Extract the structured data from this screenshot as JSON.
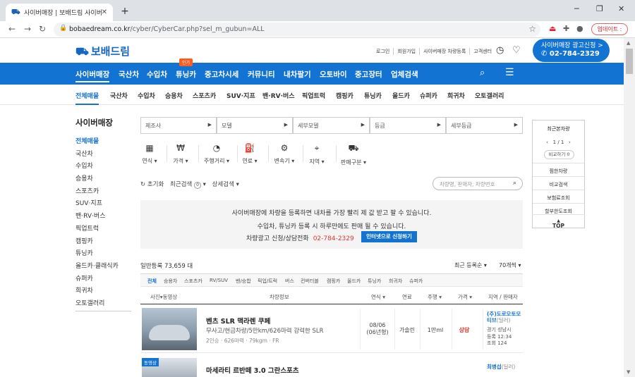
{
  "browser": {
    "tab_title": "사이버매장 | 보배드림 사이버미",
    "url_domain": "bobaedream.co.kr",
    "url_path": "/cyber/CyberCar.php?sel_m_gubun=ALL",
    "update_label": "업데이트 :"
  },
  "header": {
    "logo": "보배드림",
    "top_links": [
      "로그인",
      "회원가입",
      "사이버매장 차량등록",
      "고객센터"
    ],
    "ad_line1": "사이버매장 광고신청 >",
    "ad_line2": "02-784-2329"
  },
  "main_nav": {
    "items": [
      "사이버매장",
      "국산차",
      "수입차",
      "튜닝카",
      "중고차시세",
      "커뮤니티",
      "내차팔기",
      "오토바이",
      "중고장터",
      "업체검색"
    ],
    "hot_badge": "인기"
  },
  "sub_nav": {
    "items": [
      "전체매물",
      "국산차",
      "수입차",
      "승용차",
      "스포츠카",
      "SUV·지프",
      "밴·RV·버스",
      "픽업트럭",
      "캠핑카",
      "튜닝카",
      "올드카",
      "슈퍼카",
      "희귀차",
      "오토갤러리"
    ]
  },
  "sidebar": {
    "title": "사이버매장",
    "items": [
      "전체매물",
      "국산차",
      "수입차",
      "승용차",
      "스포츠카",
      "SUV·지프",
      "밴·RV·버스",
      "픽업트럭",
      "캠핑카",
      "튜닝카",
      "올드카·클래식카",
      "슈퍼카",
      "희귀차",
      "오토갤러리"
    ]
  },
  "filters": {
    "selects": [
      "제조사",
      "모델",
      "세부모델",
      "등급",
      "세부등급"
    ],
    "icons": [
      "연식",
      "가격",
      "주행거리",
      "연료",
      "변속기",
      "지역",
      "판매구분"
    ],
    "reset": "초기화",
    "recent_search": "최근검색",
    "recent_count": "0",
    "detail_search": "상세검색",
    "search_placeholder": "차량명, 판매자, 차량번호"
  },
  "banner": {
    "line1": "사이버매장에 차량을 등록하면 내차를 가장 빨리 제 값 받고 팔 수 있습니다.",
    "line2": "수입차, 튜닝카 등록 시 하루만에도 판매 될 수 있습니다.",
    "line3": "차량광고 신청/상담전화",
    "phone": "02-784-2329",
    "button": "인터넷으로 신청하기"
  },
  "listing": {
    "count_label": "일반등록 73,659 대",
    "sort": "최근 등록순",
    "per_page": "70개씩",
    "tabs": [
      "전체",
      "승용차",
      "스포츠카",
      "RV/SUV",
      "밴/승합",
      "픽업/트럭",
      "버스",
      "컨버터블",
      "캠핑카",
      "올드카",
      "튜닝카",
      "희귀차",
      "슈퍼카"
    ],
    "columns": [
      "사진▾동영상",
      "차량정보",
      "연식",
      "연료",
      "주행",
      "가격",
      "지역 / 판매자"
    ],
    "rows": [
      {
        "title": "벤츠 SLR 맥라렌 쿠페",
        "desc": "무사고/현금차량/5만km/626마력 강력한 SLR",
        "spec": "2인승 · 626마력 · 79kgm · FR",
        "year": "08/06",
        "year2": "(06년형)",
        "fuel": "가솔린",
        "mileage": "1만ml",
        "price": "상담",
        "seller": "(주)도로오토모티브",
        "seller_tag": "(딜러)",
        "loc": "경기 성남시",
        "reg": "등록 12:34",
        "views": "조회 124"
      },
      {
        "badge": "동영상",
        "title": "마세라티 르반떼 3.0 그란스포츠",
        "seller": "최병섭",
        "seller_tag": "(딜러)"
      }
    ]
  },
  "right_panel": {
    "title": "최근본차량",
    "page": "1 / 1",
    "compare": "비교하기 0",
    "links": [
      "찜한차량",
      "비교검색",
      "보험료조회",
      "할부한도조회"
    ],
    "top": "TOP"
  },
  "colors": {
    "brand": "#1373d3",
    "accent": "#e2352c"
  }
}
